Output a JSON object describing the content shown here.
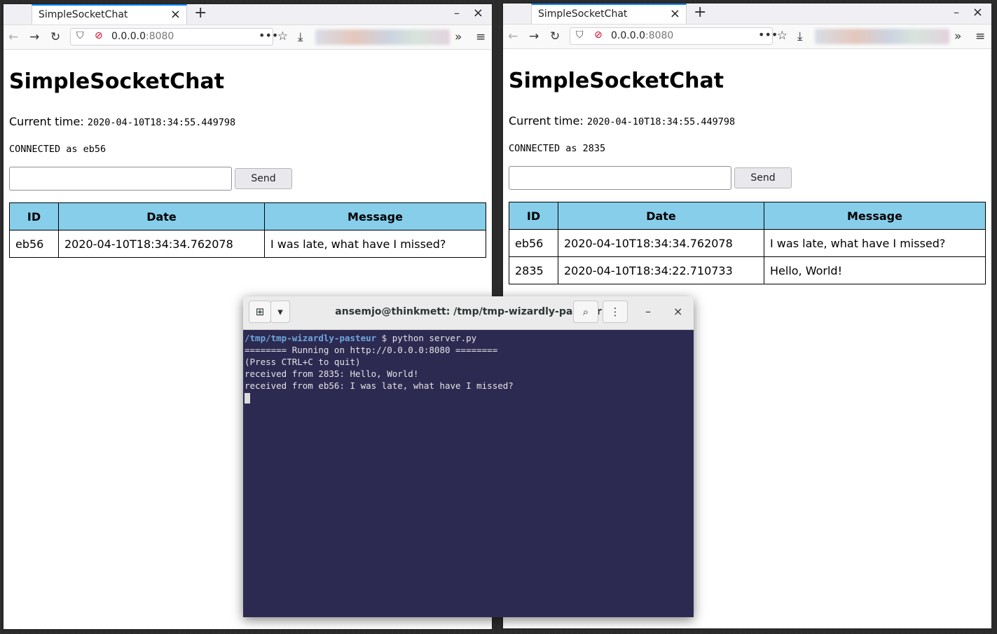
{
  "left_browser": {
    "tab_title": "SimpleSocketChat",
    "url_host": "0.0.0.0",
    "url_port": ":8080",
    "page_title": "SimpleSocketChat",
    "time_label": "Current time:",
    "time_value": "2020-04-10T18:34:55.449798",
    "status": "CONNECTED as eb56",
    "input_value": "",
    "send_label": "Send",
    "table": {
      "headers": [
        "ID",
        "Date",
        "Message"
      ],
      "rows": [
        [
          "eb56",
          "2020-04-10T18:34:34.762078",
          "I was late, what have I missed?"
        ]
      ]
    }
  },
  "right_browser": {
    "tab_title": "SimpleSocketChat",
    "url_host": "0.0.0.0",
    "url_port": ":8080",
    "page_title": "SimpleSocketChat",
    "time_label": "Current time:",
    "time_value": "2020-04-10T18:34:55.449798",
    "status": "CONNECTED as 2835",
    "input_value": "",
    "send_label": "Send",
    "table": {
      "headers": [
        "ID",
        "Date",
        "Message"
      ],
      "rows": [
        [
          "eb56",
          "2020-04-10T18:34:34.762078",
          "I was late, what have I missed?"
        ],
        [
          "2835",
          "2020-04-10T18:34:22.710733",
          "Hello, World!"
        ]
      ]
    }
  },
  "terminal": {
    "title": "ansemjo@thinkmett: /tmp/tmp-wizardly-pasteur",
    "prompt_path": "/tmp/tmp-wizardly-pasteur",
    "prompt_symbol": " $ ",
    "command": "python server.py",
    "output": [
      "======== Running on http://0.0.0.0:8080 ========",
      "(Press CTRL+C to quit)",
      "received from 2835: Hello, World!",
      "received from eb56: I was late, what have I missed?"
    ]
  },
  "icons": {
    "back": "back-arrow-icon",
    "forward": "forward-arrow-icon",
    "reload": "reload-icon",
    "shield": "shield-icon",
    "insecure": "insecure-lock-icon",
    "more": "more-dots-icon",
    "bookmark": "star-icon",
    "download": "download-icon",
    "overflow": "chevrons-icon",
    "menu": "hamburger-menu-icon"
  },
  "colors": {
    "table_header": "#87ceeb",
    "terminal_bg": "#2d2a52",
    "tab_accent": "#0a84ff",
    "prompt_path": "#6fa8dc"
  }
}
